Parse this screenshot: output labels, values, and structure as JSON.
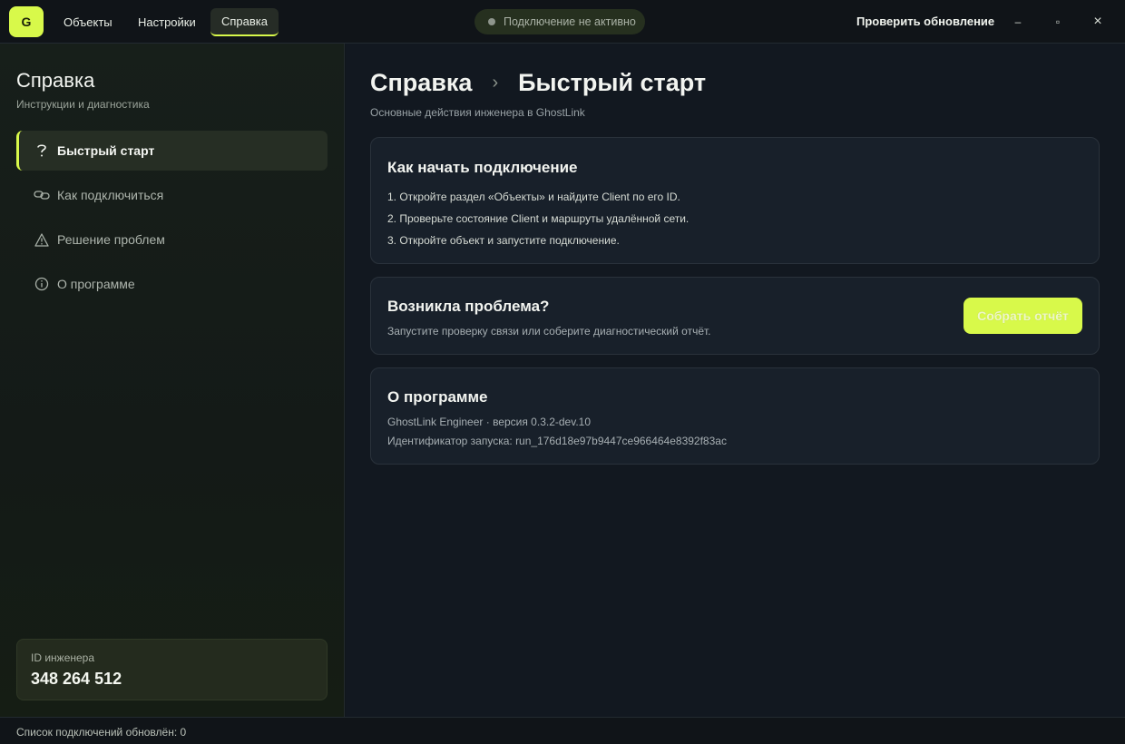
{
  "app": {
    "logo_letter": "G",
    "accent_color": "#d8f94a"
  },
  "topbar": {
    "tabs": [
      {
        "label": "Объекты",
        "active": false
      },
      {
        "label": "Настройки",
        "active": false
      },
      {
        "label": "Справка",
        "active": true
      }
    ],
    "connection_status": "Подключение не активно",
    "update_label": "Проверить обновление",
    "window_controls": {
      "minimize_icon": "minimize-icon",
      "maximize_icon": "maximize-icon",
      "close_icon": "close-icon",
      "minimize": "–",
      "maximize": "▫",
      "close": "×"
    }
  },
  "sidebar": {
    "title": "Справка",
    "subtitle": "Инструкции и диагностика",
    "items": [
      {
        "label": "Быстрый старт",
        "icon": "question-icon",
        "glyph": "?",
        "active": true
      },
      {
        "label": "Как подключиться",
        "icon": "link-icon",
        "glyph": "⚭",
        "active": false
      },
      {
        "label": "Решение проблем",
        "icon": "warning-icon",
        "glyph": "⚠",
        "active": false
      },
      {
        "label": "О программе",
        "icon": "info-icon",
        "glyph": "ⓘ",
        "active": false
      }
    ],
    "engineer": {
      "label": "ID инженера",
      "id": "348 264 512"
    }
  },
  "main": {
    "breadcrumb": {
      "root": "Справка",
      "separator": "›",
      "current": "Быстрый старт"
    },
    "subtitle": "Основные действия инженера в GhostLink",
    "start_card": {
      "title": "Как начать подключение",
      "steps": [
        "1. Откройте раздел «Объекты» и найдите Client по его ID.",
        "2. Проверьте состояние Client и маршруты удалённой сети.",
        "3. Откройте объект и запустите подключение."
      ]
    },
    "problem_card": {
      "title": "Возникла проблема?",
      "text": "Запустите проверку связи или соберите диагностический отчёт.",
      "button_label": "Собрать отчёт"
    },
    "about_card": {
      "title": "О программе",
      "version_line": "GhostLink Engineer · версия 0.3.2-dev.10",
      "run_id_line": "Идентификатор запуска: run_176d18e97b9447ce966464e8392f83ac"
    }
  },
  "statusbar": {
    "text": "Список подключений обновлён: 0"
  }
}
